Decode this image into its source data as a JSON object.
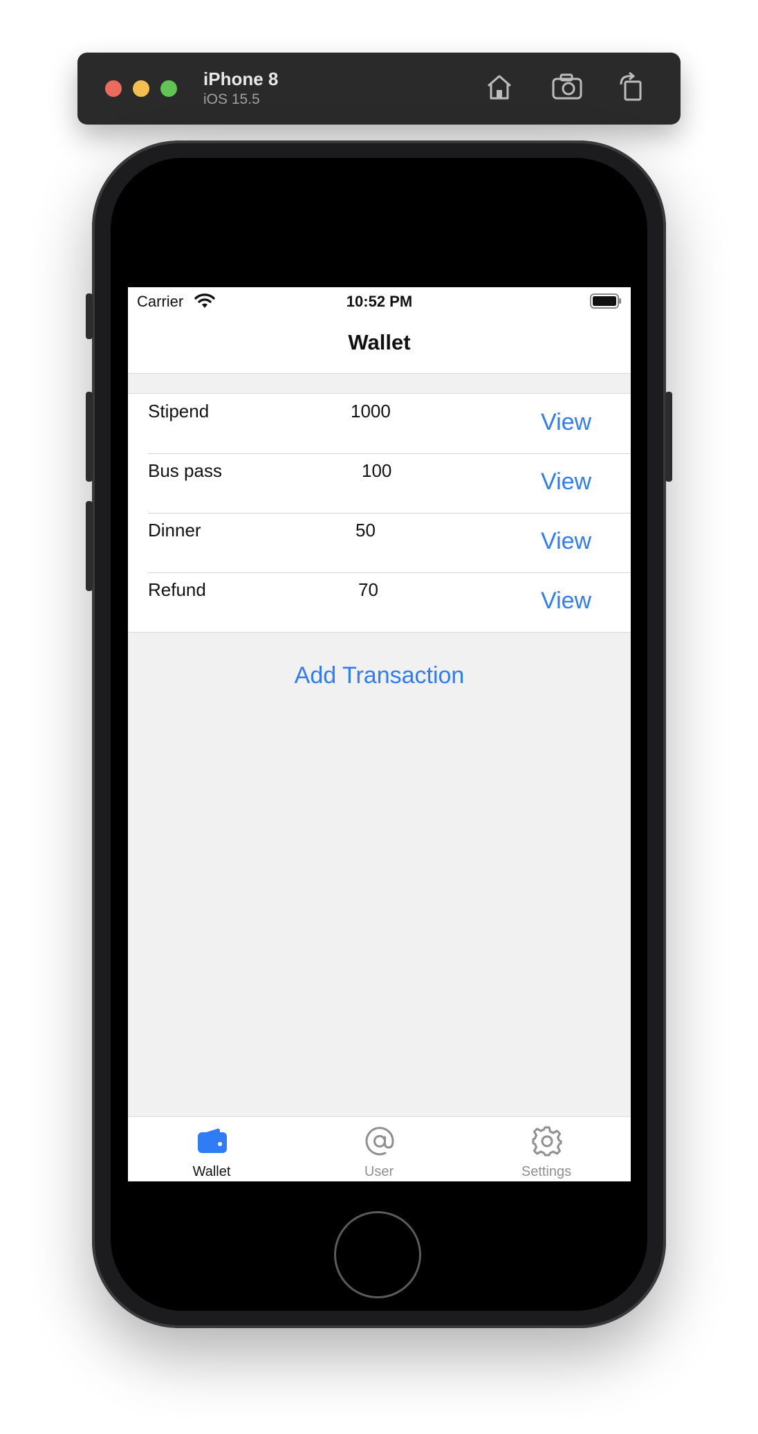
{
  "simulator": {
    "device_name": "iPhone 8",
    "os_version": "iOS 15.5",
    "buttons": {
      "home_icon": "home-icon",
      "screenshot_icon": "camera-icon",
      "rotate_icon": "rotate-icon"
    }
  },
  "status_bar": {
    "carrier": "Carrier",
    "time": "10:52 PM",
    "wifi_icon": "wifi-icon",
    "battery_icon": "battery-icon"
  },
  "nav": {
    "title": "Wallet"
  },
  "transactions": [
    {
      "name": "Stipend",
      "amount": "1000",
      "action": "View"
    },
    {
      "name": "Bus pass",
      "amount": "100",
      "action": "View"
    },
    {
      "name": "Dinner",
      "amount": "50",
      "action": "View"
    },
    {
      "name": "Refund",
      "amount": "70",
      "action": "View"
    }
  ],
  "add_button": {
    "label": "Add Transaction"
  },
  "tab_bar": {
    "tabs": [
      {
        "label": "Wallet",
        "icon": "wallet-icon",
        "selected": true
      },
      {
        "label": "User",
        "icon": "at-icon",
        "selected": false
      },
      {
        "label": "Settings",
        "icon": "gear-icon",
        "selected": false
      }
    ]
  },
  "colors": {
    "accent": "#2f7cf6",
    "background": "#f1f1f2",
    "inactive_tab": "#8e8e93"
  }
}
